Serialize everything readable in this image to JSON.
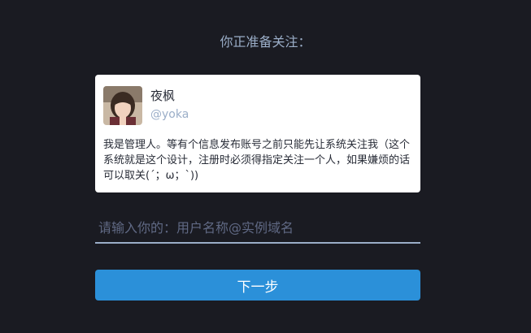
{
  "prompt": "你正准备关注：",
  "account": {
    "display_name": "夜枫",
    "username": "@yoka",
    "bio": "我是管理人。等有个信息发布账号之前只能先让系统关注我（这个系统就是这个设计，注册时必须得指定关注一个人，如果嫌烦的话可以取关(´；ω；`))",
    "avatar_icon": "user-avatar-photo"
  },
  "handle_input": {
    "value": "",
    "placeholder": "请输入你的：用户名称@实例域名"
  },
  "next_button": {
    "label": "下一步"
  },
  "colors": {
    "background": "#1a1b22",
    "accent": "#2b90d9",
    "muted": "#9baec8",
    "card": "#ffffff"
  }
}
